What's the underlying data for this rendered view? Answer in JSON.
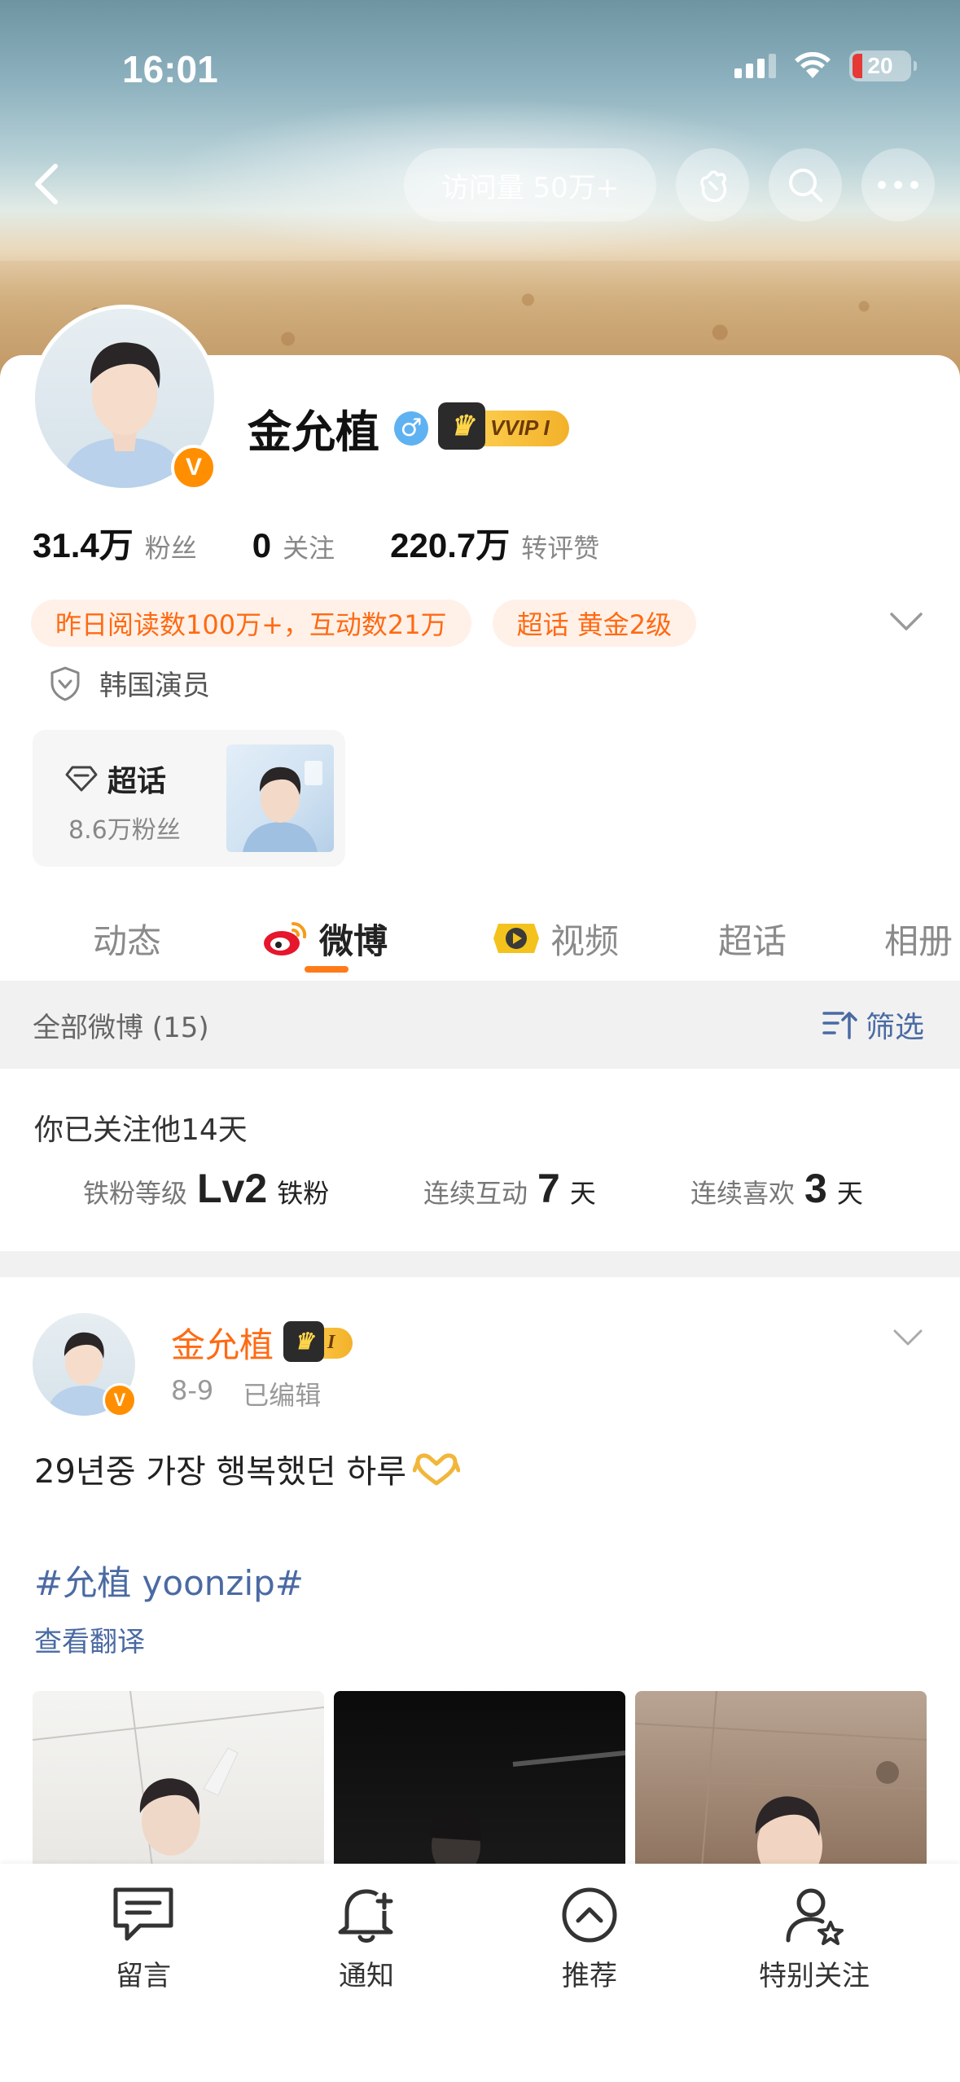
{
  "status_bar": {
    "time": "16:01",
    "battery": "20"
  },
  "header": {
    "visits_label": "访问量 50万+"
  },
  "profile": {
    "name": "金允植",
    "vip_label": "VVIP I",
    "stats": [
      {
        "value": "31.4万",
        "label": "粉丝"
      },
      {
        "value": "0",
        "label": "关注"
      },
      {
        "value": "220.7万",
        "label": "转评赞"
      }
    ],
    "tags": [
      "昨日阅读数100万+，互动数21万",
      "超话 黄金2级"
    ],
    "role": "韩国演员",
    "supertopic": {
      "title": "超话",
      "fans": "8.6万粉丝"
    }
  },
  "tabs": [
    {
      "label": "动态"
    },
    {
      "label": "微博"
    },
    {
      "label": "视频"
    },
    {
      "label": "超话"
    },
    {
      "label": "相册"
    }
  ],
  "filter_bar": {
    "all_label": "全部微博 (15)",
    "filter_label": "筛选"
  },
  "fan_info": {
    "follow_days": "你已关注他14天",
    "metrics": [
      {
        "label": "铁粉等级",
        "value": "Lv2",
        "unit": "铁粉"
      },
      {
        "label": "连续互动",
        "value": "7",
        "unit": "天"
      },
      {
        "label": "连续喜欢",
        "value": "3",
        "unit": "天"
      }
    ]
  },
  "post": {
    "author": "金允植",
    "badge_label": "I",
    "date": "8-9",
    "edited": "已编辑",
    "text": "29년중 가장 행복했던 하루",
    "hashtag": "#允植 yoonzip#",
    "translate": "查看翻译"
  },
  "bottom_bar": [
    {
      "label": "留言"
    },
    {
      "label": "通知"
    },
    {
      "label": "推荐"
    },
    {
      "label": "特别关注"
    }
  ],
  "colors": {
    "accent": "#ff6a13",
    "link": "#4a6aa3",
    "vip_gold": "#f3b12a"
  }
}
